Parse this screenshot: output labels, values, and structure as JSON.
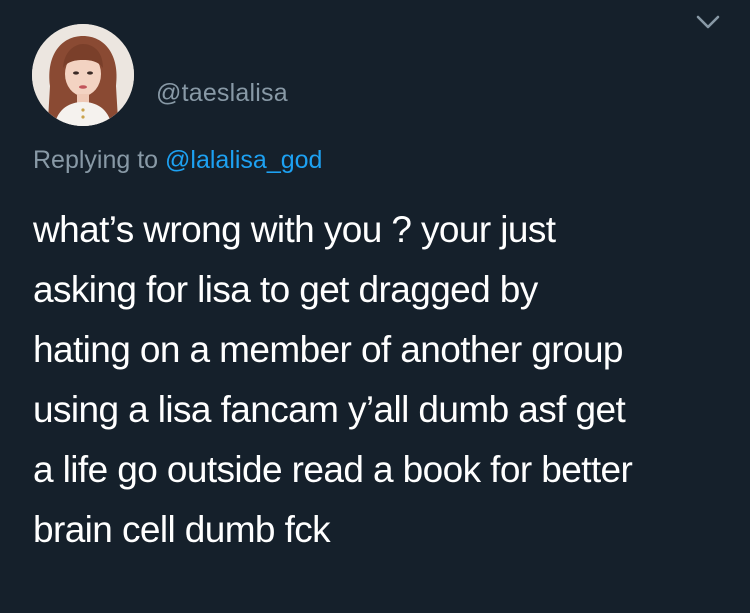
{
  "tweet": {
    "handle": "@taeslalisa",
    "avatar_icon": "profile-photo",
    "menu_icon": "chevron-down-icon",
    "replying_prefix": "Replying to",
    "replying_to": "@lalalisa_god",
    "text_lines": [
      "what’s wrong with you ? your just",
      "asking for lisa to get dragged by",
      "hating on a member of another group",
      "using a lisa fancam y’all dumb asf get",
      "a life go outside read a book for better",
      "brain cell dumb fck"
    ]
  },
  "colors": {
    "background": "#15202b",
    "secondary_text": "#8899a6",
    "link": "#1da1f2",
    "primary_text": "#ffffff"
  }
}
